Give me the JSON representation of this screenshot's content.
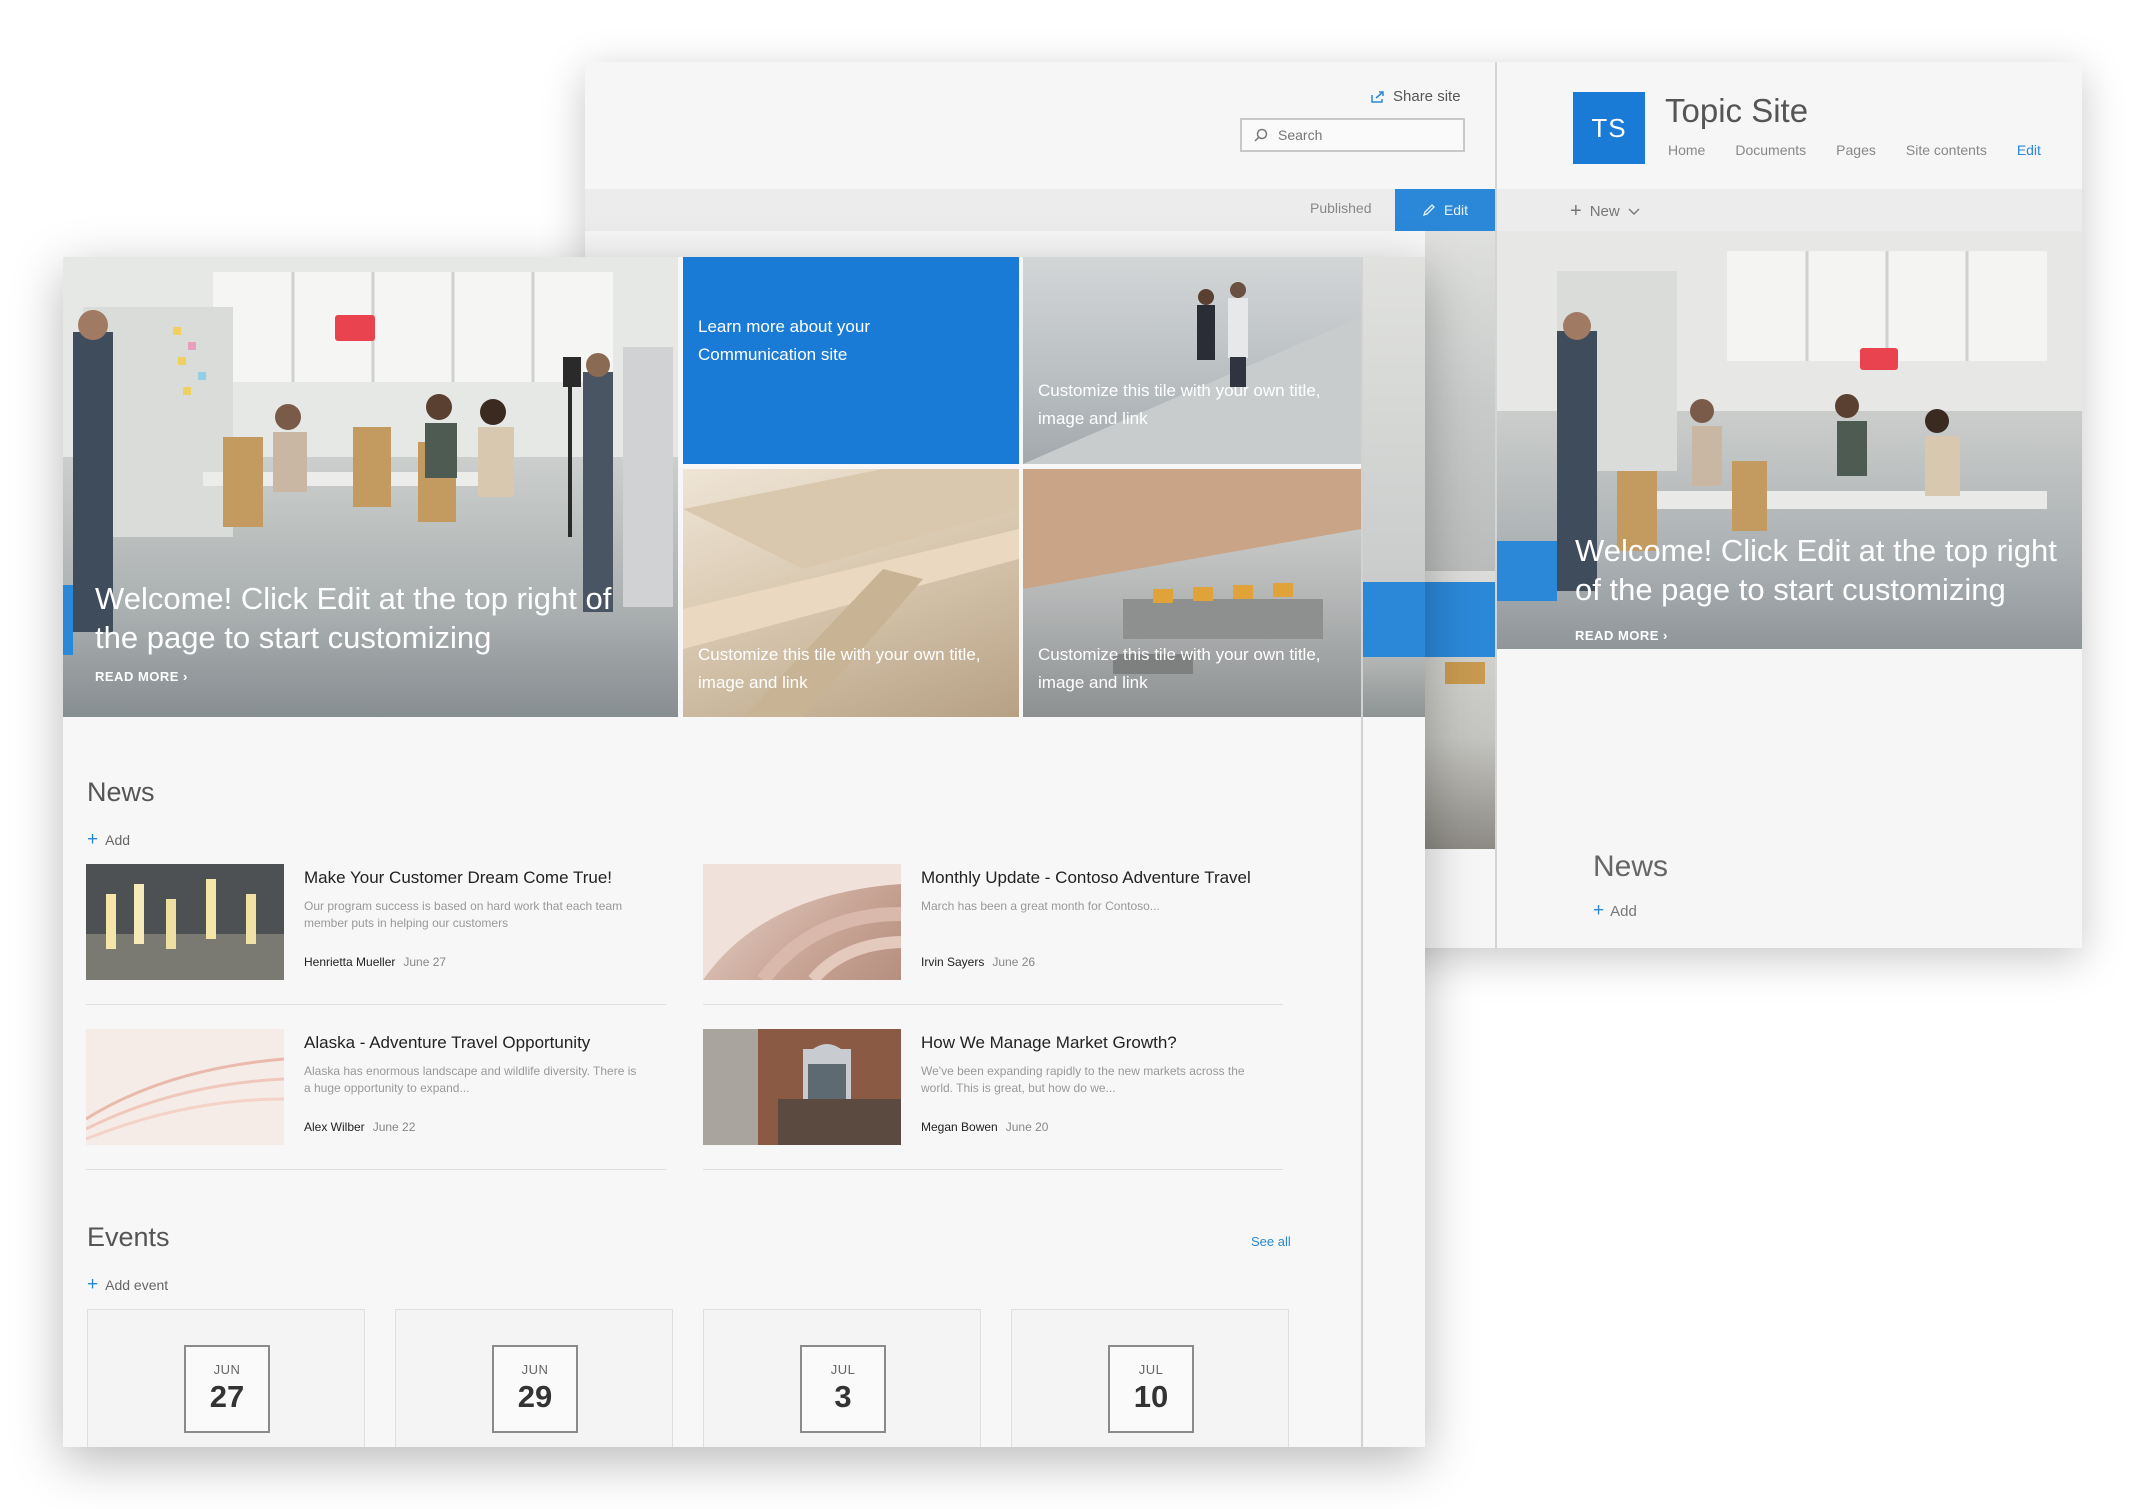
{
  "back_site": {
    "share_label": "Share site",
    "search_placeholder": "Search",
    "status_label": "Published",
    "edit_label": "Edit",
    "new_label": "New",
    "logo_initials": "TS",
    "site_title": "Topic Site",
    "nav": [
      {
        "label": "Home"
      },
      {
        "label": "Documents"
      },
      {
        "label": "Pages"
      },
      {
        "label": "Site contents"
      },
      {
        "label": "Edit"
      }
    ],
    "hero_text": "Welcome! Click Edit at the top right of the page to start customizing",
    "hero_read_more": "READ MORE ›",
    "news_title": "News",
    "add_label": "Add"
  },
  "front_site": {
    "hero_text": "Welcome! Click Edit at the top right of the page to start customizing",
    "hero_read_more": "READ MORE ›",
    "tiles": [
      {
        "caption": "Learn more about your Communication site"
      },
      {
        "caption": "Customize this tile with your own title, image and link"
      },
      {
        "caption": "Customize this tile with your own title, image and link"
      },
      {
        "caption": "Customize this tile with your own title, image and link"
      }
    ],
    "news": {
      "title": "News",
      "add_label": "Add",
      "items": [
        {
          "title": "Make Your Customer Dream Come True!",
          "desc": "Our program success is based on hard work that each team member puts in helping our customers",
          "author": "Henrietta Mueller",
          "date": "June 27"
        },
        {
          "title": "Monthly Update - Contoso Adventure Travel",
          "desc": "March has been a great month for Contoso...",
          "author": "Irvin Sayers",
          "date": "June 26"
        },
        {
          "title": "Alaska - Adventure Travel Opportunity",
          "desc": "Alaska has enormous landscape and wildlife diversity. There is a huge opportunity to expand...",
          "author": "Alex Wilber",
          "date": "June 22"
        },
        {
          "title": "How We Manage Market Growth?",
          "desc": "We've been expanding rapidly to the new markets across the world. This is great, but how do we...",
          "author": "Megan Bowen",
          "date": "June 20"
        }
      ]
    },
    "events": {
      "title": "Events",
      "add_label": "Add event",
      "see_all": "See all",
      "items": [
        {
          "month": "JUN",
          "day": "27"
        },
        {
          "month": "JUN",
          "day": "29"
        },
        {
          "month": "JUL",
          "day": "3"
        },
        {
          "month": "JUL",
          "day": "10"
        }
      ]
    }
  },
  "colors": {
    "accent": "#2b88d8",
    "tile_blue": "#1a7bd6",
    "hero_marker": "#e8434f"
  }
}
